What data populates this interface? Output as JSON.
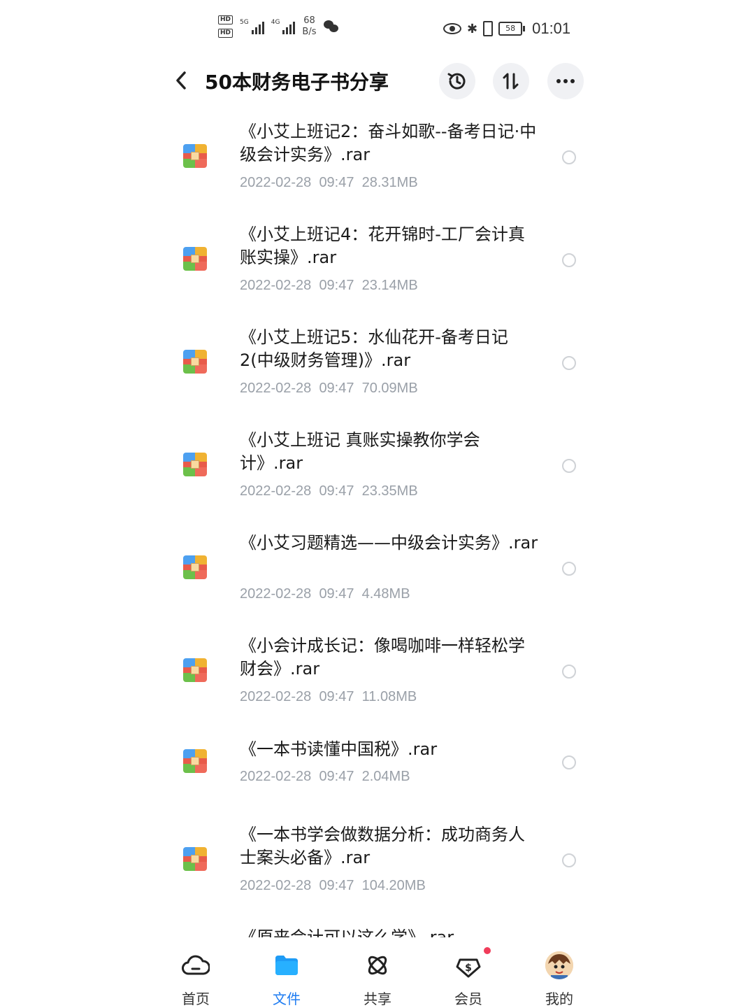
{
  "status_bar": {
    "hd_labels": [
      "HD",
      "HD"
    ],
    "sim_labels": [
      "5G",
      "4G"
    ],
    "net_speed_value": "68",
    "net_speed_unit": "B/s",
    "bluetooth_glyph": "✱",
    "battery": "58",
    "time": "01:01"
  },
  "header": {
    "title": "50本财务电子书分享",
    "back_icon": "chevron-left-icon",
    "actions": [
      "history-icon",
      "sort-icon",
      "more-icon"
    ]
  },
  "files": [
    {
      "name": "《小艾上班记2：奋斗如歌--备考日记·中级会计实务》.rar",
      "date": "2022-02-28",
      "time": "09:47",
      "size": "28.31MB"
    },
    {
      "name": "《小艾上班记4：花开锦时-工厂会计真账实操》.rar",
      "date": "2022-02-28",
      "time": "09:47",
      "size": "23.14MB"
    },
    {
      "name": "《小艾上班记5：水仙花开-备考日记2(中级财务管理)》.rar",
      "date": "2022-02-28",
      "time": "09:47",
      "size": "70.09MB"
    },
    {
      "name": "《小艾上班记 真账实操教你学会计》.rar",
      "date": "2022-02-28",
      "time": "09:47",
      "size": "23.35MB"
    },
    {
      "name": "《小艾习题精选——中级会计实务》.rar",
      "date": "2022-02-28",
      "time": "09:47",
      "size": "4.48MB"
    },
    {
      "name": "《小会计成长记：像喝咖啡一样轻松学财会》.rar",
      "date": "2022-02-28",
      "time": "09:47",
      "size": "11.08MB"
    },
    {
      "name": "《一本书读懂中国税》.rar",
      "date": "2022-02-28",
      "time": "09:47",
      "size": "2.04MB"
    },
    {
      "name": "《一本书学会做数据分析：成功商务人士案头必备》.rar",
      "date": "2022-02-28",
      "time": "09:47",
      "size": "104.20MB"
    },
    {
      "name": "《原来会计可以这么学》.rar",
      "date": "",
      "time": "",
      "size": ""
    }
  ],
  "tabs": [
    {
      "label": "首页",
      "icon": "cloud-home-icon"
    },
    {
      "label": "文件",
      "icon": "folder-icon",
      "active": true
    },
    {
      "label": "共享",
      "icon": "share-atom-icon"
    },
    {
      "label": "会员",
      "icon": "vip-diamond-icon",
      "badge": true
    },
    {
      "label": "我的",
      "icon": "avatar-icon"
    }
  ],
  "colors": {
    "accent": "#1e7cf2",
    "meta_text": "#9aa0a8",
    "badge": "#f03c5a"
  }
}
